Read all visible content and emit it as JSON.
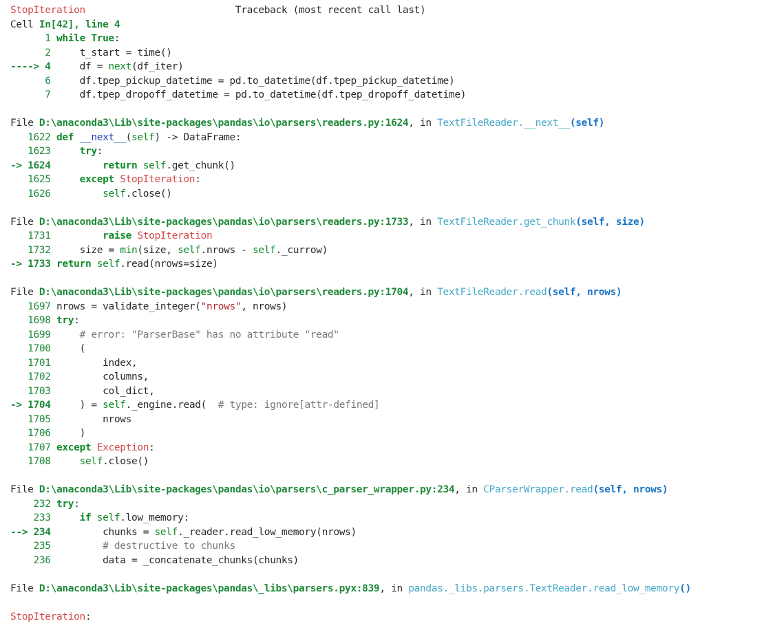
{
  "traceback": {
    "lines": [
      [
        {
          "t": "StopIteration",
          "c": "red"
        },
        {
          "t": "                          Traceback (most recent call last)",
          "c": "plain"
        }
      ],
      [
        {
          "t": "Cell ",
          "c": "plain"
        },
        {
          "t": "In[42], line 4",
          "c": "grnb"
        }
      ],
      [
        {
          "t": "      1 ",
          "c": "grn"
        },
        {
          "t": "while",
          "c": "kw"
        },
        {
          "t": " ",
          "c": "plain"
        },
        {
          "t": "True",
          "c": "kw"
        },
        {
          "t": ":",
          "c": "plain"
        }
      ],
      [
        {
          "t": "      2 ",
          "c": "grn"
        },
        {
          "t": "    t_start ",
          "c": "plain"
        },
        {
          "t": "=",
          "c": "plain"
        },
        {
          "t": " time()",
          "c": "plain"
        }
      ],
      [
        {
          "t": "----> 4 ",
          "c": "grnb"
        },
        {
          "t": "    df ",
          "c": "plain"
        },
        {
          "t": "=",
          "c": "plain"
        },
        {
          "t": " ",
          "c": "plain"
        },
        {
          "t": "next",
          "c": "fn"
        },
        {
          "t": "(df_iter)",
          "c": "plain"
        }
      ],
      [
        {
          "t": "      6 ",
          "c": "grn"
        },
        {
          "t": "    df",
          "c": "plain"
        },
        {
          "t": ".",
          "c": "plain"
        },
        {
          "t": "tpep_pickup_datetime ",
          "c": "plain"
        },
        {
          "t": "=",
          "c": "plain"
        },
        {
          "t": " pd",
          "c": "plain"
        },
        {
          "t": ".",
          "c": "plain"
        },
        {
          "t": "to_datetime(df",
          "c": "plain"
        },
        {
          "t": ".",
          "c": "plain"
        },
        {
          "t": "tpep_pickup_datetime)",
          "c": "plain"
        }
      ],
      [
        {
          "t": "      7 ",
          "c": "grn"
        },
        {
          "t": "    df",
          "c": "plain"
        },
        {
          "t": ".",
          "c": "plain"
        },
        {
          "t": "tpep_dropoff_datetime ",
          "c": "plain"
        },
        {
          "t": "=",
          "c": "plain"
        },
        {
          "t": " pd",
          "c": "plain"
        },
        {
          "t": ".",
          "c": "plain"
        },
        {
          "t": "to_datetime(df",
          "c": "plain"
        },
        {
          "t": ".",
          "c": "plain"
        },
        {
          "t": "tpep_dropoff_datetime)",
          "c": "plain"
        }
      ],
      [],
      [
        {
          "t": "File ",
          "c": "plain"
        },
        {
          "t": "D:\\anaconda3\\Lib\\site-packages\\pandas\\io\\parsers\\readers.py:1624",
          "c": "grnb"
        },
        {
          "t": ", in ",
          "c": "plain"
        },
        {
          "t": "TextFileReader.__next__",
          "c": "cyan"
        },
        {
          "t": "(self)",
          "c": "blub"
        }
      ],
      [
        {
          "t": "   1622 ",
          "c": "grn"
        },
        {
          "t": "def",
          "c": "kw"
        },
        {
          "t": " ",
          "c": "plain"
        },
        {
          "t": "__next__",
          "c": "blu"
        },
        {
          "t": "(",
          "c": "plain"
        },
        {
          "t": "self",
          "c": "self"
        },
        {
          "t": ") ",
          "c": "plain"
        },
        {
          "t": "->",
          "c": "plain"
        },
        {
          "t": " DataFrame:",
          "c": "plain"
        }
      ],
      [
        {
          "t": "   1623 ",
          "c": "grn"
        },
        {
          "t": "    ",
          "c": "plain"
        },
        {
          "t": "try",
          "c": "kw"
        },
        {
          "t": ":",
          "c": "plain"
        }
      ],
      [
        {
          "t": "-> 1624 ",
          "c": "grnb"
        },
        {
          "t": "        ",
          "c": "plain"
        },
        {
          "t": "return",
          "c": "kw"
        },
        {
          "t": " ",
          "c": "plain"
        },
        {
          "t": "self",
          "c": "self"
        },
        {
          "t": ".",
          "c": "plain"
        },
        {
          "t": "get_chunk()",
          "c": "plain"
        }
      ],
      [
        {
          "t": "   1625 ",
          "c": "grn"
        },
        {
          "t": "    ",
          "c": "plain"
        },
        {
          "t": "except",
          "c": "kw"
        },
        {
          "t": " ",
          "c": "plain"
        },
        {
          "t": "StopIteration",
          "c": "exc"
        },
        {
          "t": ":",
          "c": "plain"
        }
      ],
      [
        {
          "t": "   1626 ",
          "c": "grn"
        },
        {
          "t": "        ",
          "c": "plain"
        },
        {
          "t": "self",
          "c": "self"
        },
        {
          "t": ".",
          "c": "plain"
        },
        {
          "t": "close()",
          "c": "plain"
        }
      ],
      [],
      [
        {
          "t": "File ",
          "c": "plain"
        },
        {
          "t": "D:\\anaconda3\\Lib\\site-packages\\pandas\\io\\parsers\\readers.py:1733",
          "c": "grnb"
        },
        {
          "t": ", in ",
          "c": "plain"
        },
        {
          "t": "TextFileReader.get_chunk",
          "c": "cyan"
        },
        {
          "t": "(self, size)",
          "c": "blub"
        }
      ],
      [
        {
          "t": "   1731 ",
          "c": "grn"
        },
        {
          "t": "        ",
          "c": "plain"
        },
        {
          "t": "raise",
          "c": "kw"
        },
        {
          "t": " ",
          "c": "plain"
        },
        {
          "t": "StopIteration",
          "c": "exc"
        }
      ],
      [
        {
          "t": "   1732 ",
          "c": "grn"
        },
        {
          "t": "    size ",
          "c": "plain"
        },
        {
          "t": "=",
          "c": "plain"
        },
        {
          "t": " ",
          "c": "plain"
        },
        {
          "t": "min",
          "c": "fn"
        },
        {
          "t": "(size, ",
          "c": "plain"
        },
        {
          "t": "self",
          "c": "self"
        },
        {
          "t": ".",
          "c": "plain"
        },
        {
          "t": "nrows ",
          "c": "plain"
        },
        {
          "t": "-",
          "c": "plain"
        },
        {
          "t": " ",
          "c": "plain"
        },
        {
          "t": "self",
          "c": "self"
        },
        {
          "t": ".",
          "c": "plain"
        },
        {
          "t": "_currow)",
          "c": "plain"
        }
      ],
      [
        {
          "t": "-> 1733 ",
          "c": "grnb"
        },
        {
          "t": "return",
          "c": "kw"
        },
        {
          "t": " ",
          "c": "plain"
        },
        {
          "t": "self",
          "c": "self"
        },
        {
          "t": ".",
          "c": "plain"
        },
        {
          "t": "read(nrows",
          "c": "plain"
        },
        {
          "t": "=",
          "c": "plain"
        },
        {
          "t": "size)",
          "c": "plain"
        }
      ],
      [],
      [
        {
          "t": "File ",
          "c": "plain"
        },
        {
          "t": "D:\\anaconda3\\Lib\\site-packages\\pandas\\io\\parsers\\readers.py:1704",
          "c": "grnb"
        },
        {
          "t": ", in ",
          "c": "plain"
        },
        {
          "t": "TextFileReader.read",
          "c": "cyan"
        },
        {
          "t": "(self, nrows)",
          "c": "blub"
        }
      ],
      [
        {
          "t": "   1697 ",
          "c": "grn"
        },
        {
          "t": "nrows ",
          "c": "plain"
        },
        {
          "t": "=",
          "c": "plain"
        },
        {
          "t": " validate_integer(",
          "c": "plain"
        },
        {
          "t": "\"nrows\"",
          "c": "str"
        },
        {
          "t": ", nrows)",
          "c": "plain"
        }
      ],
      [
        {
          "t": "   1698 ",
          "c": "grn"
        },
        {
          "t": "try",
          "c": "kw"
        },
        {
          "t": ":",
          "c": "plain"
        }
      ],
      [
        {
          "t": "   1699 ",
          "c": "grn"
        },
        {
          "t": "    ",
          "c": "plain"
        },
        {
          "t": "# error: \"ParserBase\" has no attribute \"read\"",
          "c": "cmt"
        }
      ],
      [
        {
          "t": "   1700 ",
          "c": "grn"
        },
        {
          "t": "    (",
          "c": "plain"
        }
      ],
      [
        {
          "t": "   1701 ",
          "c": "grn"
        },
        {
          "t": "        index,",
          "c": "plain"
        }
      ],
      [
        {
          "t": "   1702 ",
          "c": "grn"
        },
        {
          "t": "        columns,",
          "c": "plain"
        }
      ],
      [
        {
          "t": "   1703 ",
          "c": "grn"
        },
        {
          "t": "        col_dict,",
          "c": "plain"
        }
      ],
      [
        {
          "t": "-> 1704 ",
          "c": "grnb"
        },
        {
          "t": "    ) ",
          "c": "plain"
        },
        {
          "t": "=",
          "c": "plain"
        },
        {
          "t": " ",
          "c": "plain"
        },
        {
          "t": "self",
          "c": "self"
        },
        {
          "t": ".",
          "c": "plain"
        },
        {
          "t": "_engine",
          "c": "plain"
        },
        {
          "t": ".",
          "c": "plain"
        },
        {
          "t": "read(  ",
          "c": "plain"
        },
        {
          "t": "# type: ignore[attr-defined]",
          "c": "cmt"
        }
      ],
      [
        {
          "t": "   1705 ",
          "c": "grn"
        },
        {
          "t": "        nrows",
          "c": "plain"
        }
      ],
      [
        {
          "t": "   1706 ",
          "c": "grn"
        },
        {
          "t": "    )",
          "c": "plain"
        }
      ],
      [
        {
          "t": "   1707 ",
          "c": "grn"
        },
        {
          "t": "except",
          "c": "kw"
        },
        {
          "t": " ",
          "c": "plain"
        },
        {
          "t": "Exception",
          "c": "exc"
        },
        {
          "t": ":",
          "c": "plain"
        }
      ],
      [
        {
          "t": "   1708 ",
          "c": "grn"
        },
        {
          "t": "    ",
          "c": "plain"
        },
        {
          "t": "self",
          "c": "self"
        },
        {
          "t": ".",
          "c": "plain"
        },
        {
          "t": "close()",
          "c": "plain"
        }
      ],
      [],
      [
        {
          "t": "File ",
          "c": "plain"
        },
        {
          "t": "D:\\anaconda3\\Lib\\site-packages\\pandas\\io\\parsers\\c_parser_wrapper.py:234",
          "c": "grnb"
        },
        {
          "t": ", in ",
          "c": "plain"
        },
        {
          "t": "CParserWrapper.read",
          "c": "cyan"
        },
        {
          "t": "(self, nrows)",
          "c": "blub"
        }
      ],
      [
        {
          "t": "    232 ",
          "c": "grn"
        },
        {
          "t": "try",
          "c": "kw"
        },
        {
          "t": ":",
          "c": "plain"
        }
      ],
      [
        {
          "t": "    233 ",
          "c": "grn"
        },
        {
          "t": "    ",
          "c": "plain"
        },
        {
          "t": "if",
          "c": "kw"
        },
        {
          "t": " ",
          "c": "plain"
        },
        {
          "t": "self",
          "c": "self"
        },
        {
          "t": ".",
          "c": "plain"
        },
        {
          "t": "low_memory:",
          "c": "plain"
        }
      ],
      [
        {
          "t": "--> 234 ",
          "c": "grnb"
        },
        {
          "t": "        chunks ",
          "c": "plain"
        },
        {
          "t": "=",
          "c": "plain"
        },
        {
          "t": " ",
          "c": "plain"
        },
        {
          "t": "self",
          "c": "self"
        },
        {
          "t": ".",
          "c": "plain"
        },
        {
          "t": "_reader",
          "c": "plain"
        },
        {
          "t": ".",
          "c": "plain"
        },
        {
          "t": "read_low_memory(nrows)",
          "c": "plain"
        }
      ],
      [
        {
          "t": "    235 ",
          "c": "grn"
        },
        {
          "t": "        ",
          "c": "plain"
        },
        {
          "t": "# destructive to chunks",
          "c": "cmt"
        }
      ],
      [
        {
          "t": "    236 ",
          "c": "grn"
        },
        {
          "t": "        data ",
          "c": "plain"
        },
        {
          "t": "=",
          "c": "plain"
        },
        {
          "t": " _concatenate_chunks(chunks)",
          "c": "plain"
        }
      ],
      [],
      [
        {
          "t": "File ",
          "c": "plain"
        },
        {
          "t": "D:\\anaconda3\\Lib\\site-packages\\pandas\\_libs\\parsers.pyx:839",
          "c": "grnb"
        },
        {
          "t": ", in ",
          "c": "plain"
        },
        {
          "t": "pandas._libs.parsers.TextReader.read_low_memory",
          "c": "cyan"
        },
        {
          "t": "()",
          "c": "blub"
        }
      ],
      [],
      [
        {
          "t": "StopIteration",
          "c": "red"
        },
        {
          "t": ":",
          "c": "plain"
        }
      ]
    ]
  }
}
